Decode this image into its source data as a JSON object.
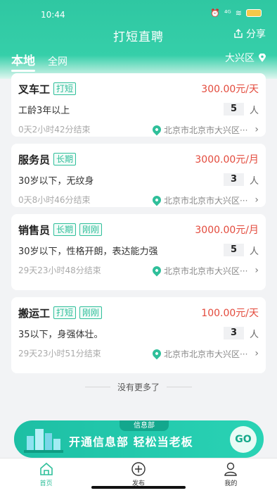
{
  "status": {
    "time": "10:44",
    "signal": "⁴ᴳ",
    "wifi": "≋"
  },
  "header": {
    "title": "打短直聘",
    "share_label": "分享"
  },
  "tabs": [
    {
      "label": "本地",
      "active": true
    },
    {
      "label": "全网",
      "active": false
    }
  ],
  "location": {
    "label": "大兴区"
  },
  "jobs": [
    {
      "title": "叉车工",
      "tags": [
        "打短"
      ],
      "salary": "300.00元/天",
      "requirement": "工龄3年以上",
      "count": "5",
      "unit": "人",
      "countdown": "0天2小时42分结束",
      "address": "北京市北京市大兴区···"
    },
    {
      "title": "服务员",
      "tags": [
        "长期"
      ],
      "salary": "3000.00元/月",
      "requirement": "30岁以下，无纹身",
      "count": "3",
      "unit": "人",
      "countdown": "0天8小时46分结束",
      "address": "北京市北京市大兴区···"
    },
    {
      "title": "销售员",
      "tags": [
        "长期",
        "刚刚"
      ],
      "salary": "3000.00元/月",
      "requirement": "30岁以下，性格开朗，表达能力强",
      "count": "5",
      "unit": "人",
      "countdown": "29天23小时48分结束",
      "address": "北京市北京市大兴区···"
    },
    {
      "title": "搬运工",
      "tags": [
        "打短",
        "刚刚"
      ],
      "salary": "100.00元/天",
      "requirement": "35以下，身强体壮。",
      "count": "3",
      "unit": "人",
      "countdown": "29天23小时51分结束",
      "address": "北京市北京市大兴区···"
    }
  ],
  "list_footer": "没有更多了",
  "banner": {
    "tag": "信息部",
    "text": "开通信息部 轻松当老板",
    "go_label": "GO"
  },
  "tabbar": [
    {
      "label": "首页",
      "icon": "home-icon",
      "active": true
    },
    {
      "label": "发布",
      "icon": "plus-circle-icon",
      "active": false
    },
    {
      "label": "我的",
      "icon": "user-icon",
      "active": false
    }
  ],
  "colors": {
    "accent": "#2fbf9a",
    "salary": "#e34a3c"
  }
}
